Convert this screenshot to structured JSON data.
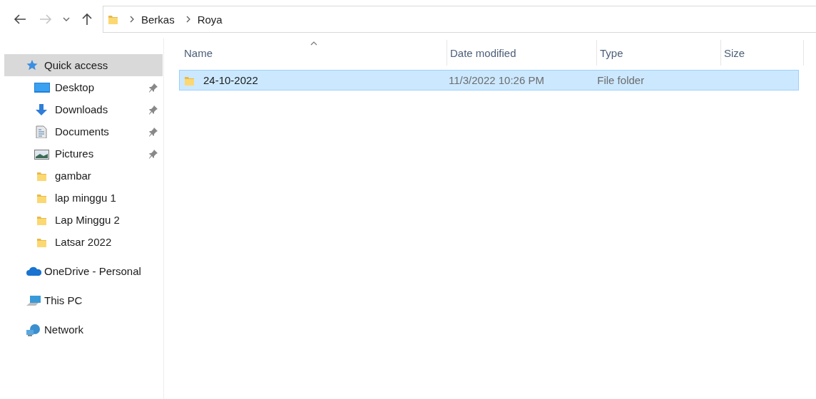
{
  "navigation": {
    "back": {
      "disabled": false
    },
    "forward": {
      "disabled": true
    }
  },
  "address_bar": {
    "crumbs": [
      "Berkas",
      "Roya"
    ]
  },
  "sidebar": {
    "items": [
      {
        "label": "Quick access",
        "kind": "star",
        "selected": true,
        "children": [
          {
            "label": "Desktop",
            "kind": "desktop",
            "pinned": true,
            "selected": false
          },
          {
            "label": "Downloads",
            "kind": "download",
            "pinned": true,
            "selected": false
          },
          {
            "label": "Documents",
            "kind": "document",
            "pinned": true,
            "selected": false
          },
          {
            "label": "Pictures",
            "kind": "pictures",
            "pinned": true,
            "selected": false
          },
          {
            "label": "gambar",
            "kind": "folder",
            "pinned": false,
            "selected": false
          },
          {
            "label": "lap minggu 1",
            "kind": "folder",
            "pinned": false,
            "selected": false
          },
          {
            "label": "Lap Minggu 2",
            "kind": "folder",
            "pinned": false,
            "selected": false
          },
          {
            "label": "Latsar 2022",
            "kind": "folder",
            "pinned": false,
            "selected": false
          }
        ]
      },
      {
        "label": "OneDrive - Personal",
        "kind": "cloud",
        "selected": false
      },
      {
        "label": "This PC",
        "kind": "computer",
        "selected": false
      },
      {
        "label": "Network",
        "kind": "network",
        "selected": false
      }
    ]
  },
  "file_list": {
    "columns": [
      {
        "label": "Name",
        "sorted": true
      },
      {
        "label": "Date modified",
        "sorted": false
      },
      {
        "label": "Type",
        "sorted": false
      },
      {
        "label": "Size",
        "sorted": false
      }
    ],
    "rows": [
      {
        "name": "24-10-2022",
        "date_modified": "11/3/2022 10:26 PM",
        "type": "File folder",
        "selected": true
      }
    ]
  }
}
